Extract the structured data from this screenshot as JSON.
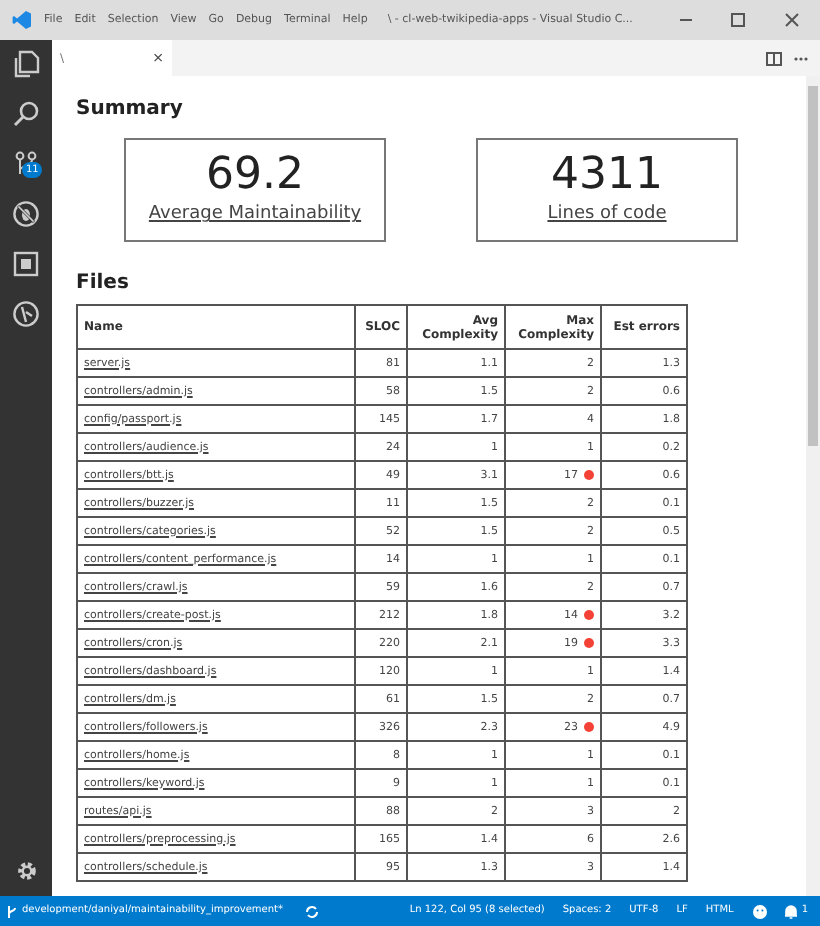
{
  "title_bar": {
    "menu": [
      "File",
      "Edit",
      "Selection",
      "View",
      "Go",
      "Debug",
      "Terminal",
      "Help"
    ],
    "title": "\\ - cl-web-twikipedia-apps - Visual Studio C..."
  },
  "activity_bar": {
    "source_control_badge": "11"
  },
  "tab": {
    "label": "\\",
    "close": "×"
  },
  "summary": {
    "heading": "Summary",
    "cards": [
      {
        "value": "69.2",
        "label": "Average Maintainability"
      },
      {
        "value": "4311",
        "label": "Lines of code"
      }
    ]
  },
  "files": {
    "heading": "Files",
    "columns": [
      "Name",
      "SLOC",
      "Avg Complexity",
      "Max Complexity",
      "Est errors"
    ],
    "rows": [
      {
        "name": "server.js",
        "sloc": "81",
        "avg": "1.1",
        "max": "2",
        "warning": false,
        "errors": "1.3"
      },
      {
        "name": "controllers/admin.js",
        "sloc": "58",
        "avg": "1.5",
        "max": "2",
        "warning": false,
        "errors": "0.6"
      },
      {
        "name": "config/passport.js",
        "sloc": "145",
        "avg": "1.7",
        "max": "4",
        "warning": false,
        "errors": "1.8"
      },
      {
        "name": "controllers/audience.js",
        "sloc": "24",
        "avg": "1",
        "max": "1",
        "warning": false,
        "errors": "0.2"
      },
      {
        "name": "controllers/btt.js",
        "sloc": "49",
        "avg": "3.1",
        "max": "17",
        "warning": true,
        "errors": "0.6"
      },
      {
        "name": "controllers/buzzer.js",
        "sloc": "11",
        "avg": "1.5",
        "max": "2",
        "warning": false,
        "errors": "0.1"
      },
      {
        "name": "controllers/categories.js",
        "sloc": "52",
        "avg": "1.5",
        "max": "2",
        "warning": false,
        "errors": "0.5"
      },
      {
        "name": "controllers/content_performance.js",
        "sloc": "14",
        "avg": "1",
        "max": "1",
        "warning": false,
        "errors": "0.1"
      },
      {
        "name": "controllers/crawl.js",
        "sloc": "59",
        "avg": "1.6",
        "max": "2",
        "warning": false,
        "errors": "0.7"
      },
      {
        "name": "controllers/create-post.js",
        "sloc": "212",
        "avg": "1.8",
        "max": "14",
        "warning": true,
        "errors": "3.2"
      },
      {
        "name": "controllers/cron.js",
        "sloc": "220",
        "avg": "2.1",
        "max": "19",
        "warning": true,
        "errors": "3.3"
      },
      {
        "name": "controllers/dashboard.js",
        "sloc": "120",
        "avg": "1",
        "max": "1",
        "warning": false,
        "errors": "1.4"
      },
      {
        "name": "controllers/dm.js",
        "sloc": "61",
        "avg": "1.5",
        "max": "2",
        "warning": false,
        "errors": "0.7"
      },
      {
        "name": "controllers/followers.js",
        "sloc": "326",
        "avg": "2.3",
        "max": "23",
        "warning": true,
        "errors": "4.9"
      },
      {
        "name": "controllers/home.js",
        "sloc": "8",
        "avg": "1",
        "max": "1",
        "warning": false,
        "errors": "0.1"
      },
      {
        "name": "controllers/keyword.js",
        "sloc": "9",
        "avg": "1",
        "max": "1",
        "warning": false,
        "errors": "0.1"
      },
      {
        "name": "routes/api.js",
        "sloc": "88",
        "avg": "2",
        "max": "3",
        "warning": false,
        "errors": "2"
      },
      {
        "name": "controllers/preprocessing.js",
        "sloc": "165",
        "avg": "1.4",
        "max": "6",
        "warning": false,
        "errors": "2.6"
      },
      {
        "name": "controllers/schedule.js",
        "sloc": "95",
        "avg": "1.3",
        "max": "3",
        "warning": false,
        "errors": "1.4"
      }
    ]
  },
  "status_bar": {
    "branch": "development/daniyal/maintainability_improvement*",
    "position": "Ln 122, Col 95 (8 selected)",
    "spaces": "Spaces: 2",
    "encoding": "UTF-8",
    "eol": "LF",
    "language": "HTML",
    "notifications": "1"
  }
}
